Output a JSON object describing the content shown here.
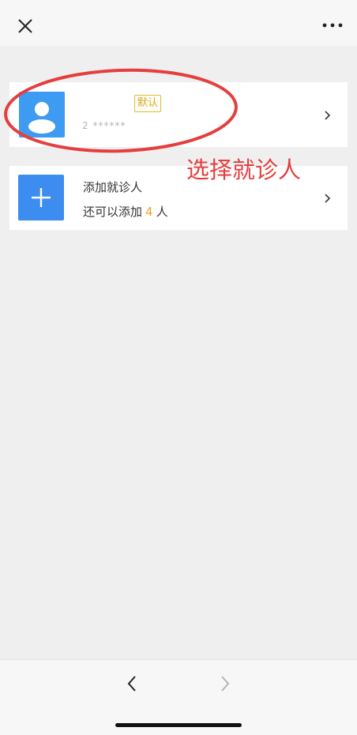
{
  "topbar": {
    "close_icon": "close-icon",
    "more_icon": "more-dots-icon"
  },
  "patient_card": {
    "default_badge": "默认",
    "masked_id": "2           ******",
    "avatar_icon": "person-avatar-icon",
    "chevron_icon": "chevron-right-icon"
  },
  "add_card": {
    "title": "添加就诊人",
    "sub_prefix": "还可以添加",
    "remaining": "4",
    "sub_suffix": "人",
    "plus_icon": "plus-icon",
    "chevron_icon": "chevron-right-icon"
  },
  "annotation": {
    "text": "选择就诊人",
    "color": "#e53e3e"
  },
  "bottombar": {
    "back_icon": "chevron-left-icon",
    "forward_icon": "chevron-right-icon"
  },
  "colors": {
    "accent": "#3d9bf2",
    "badge": "#d8aa2a",
    "highlight_number": "#e8a72a",
    "background": "#efefef"
  }
}
